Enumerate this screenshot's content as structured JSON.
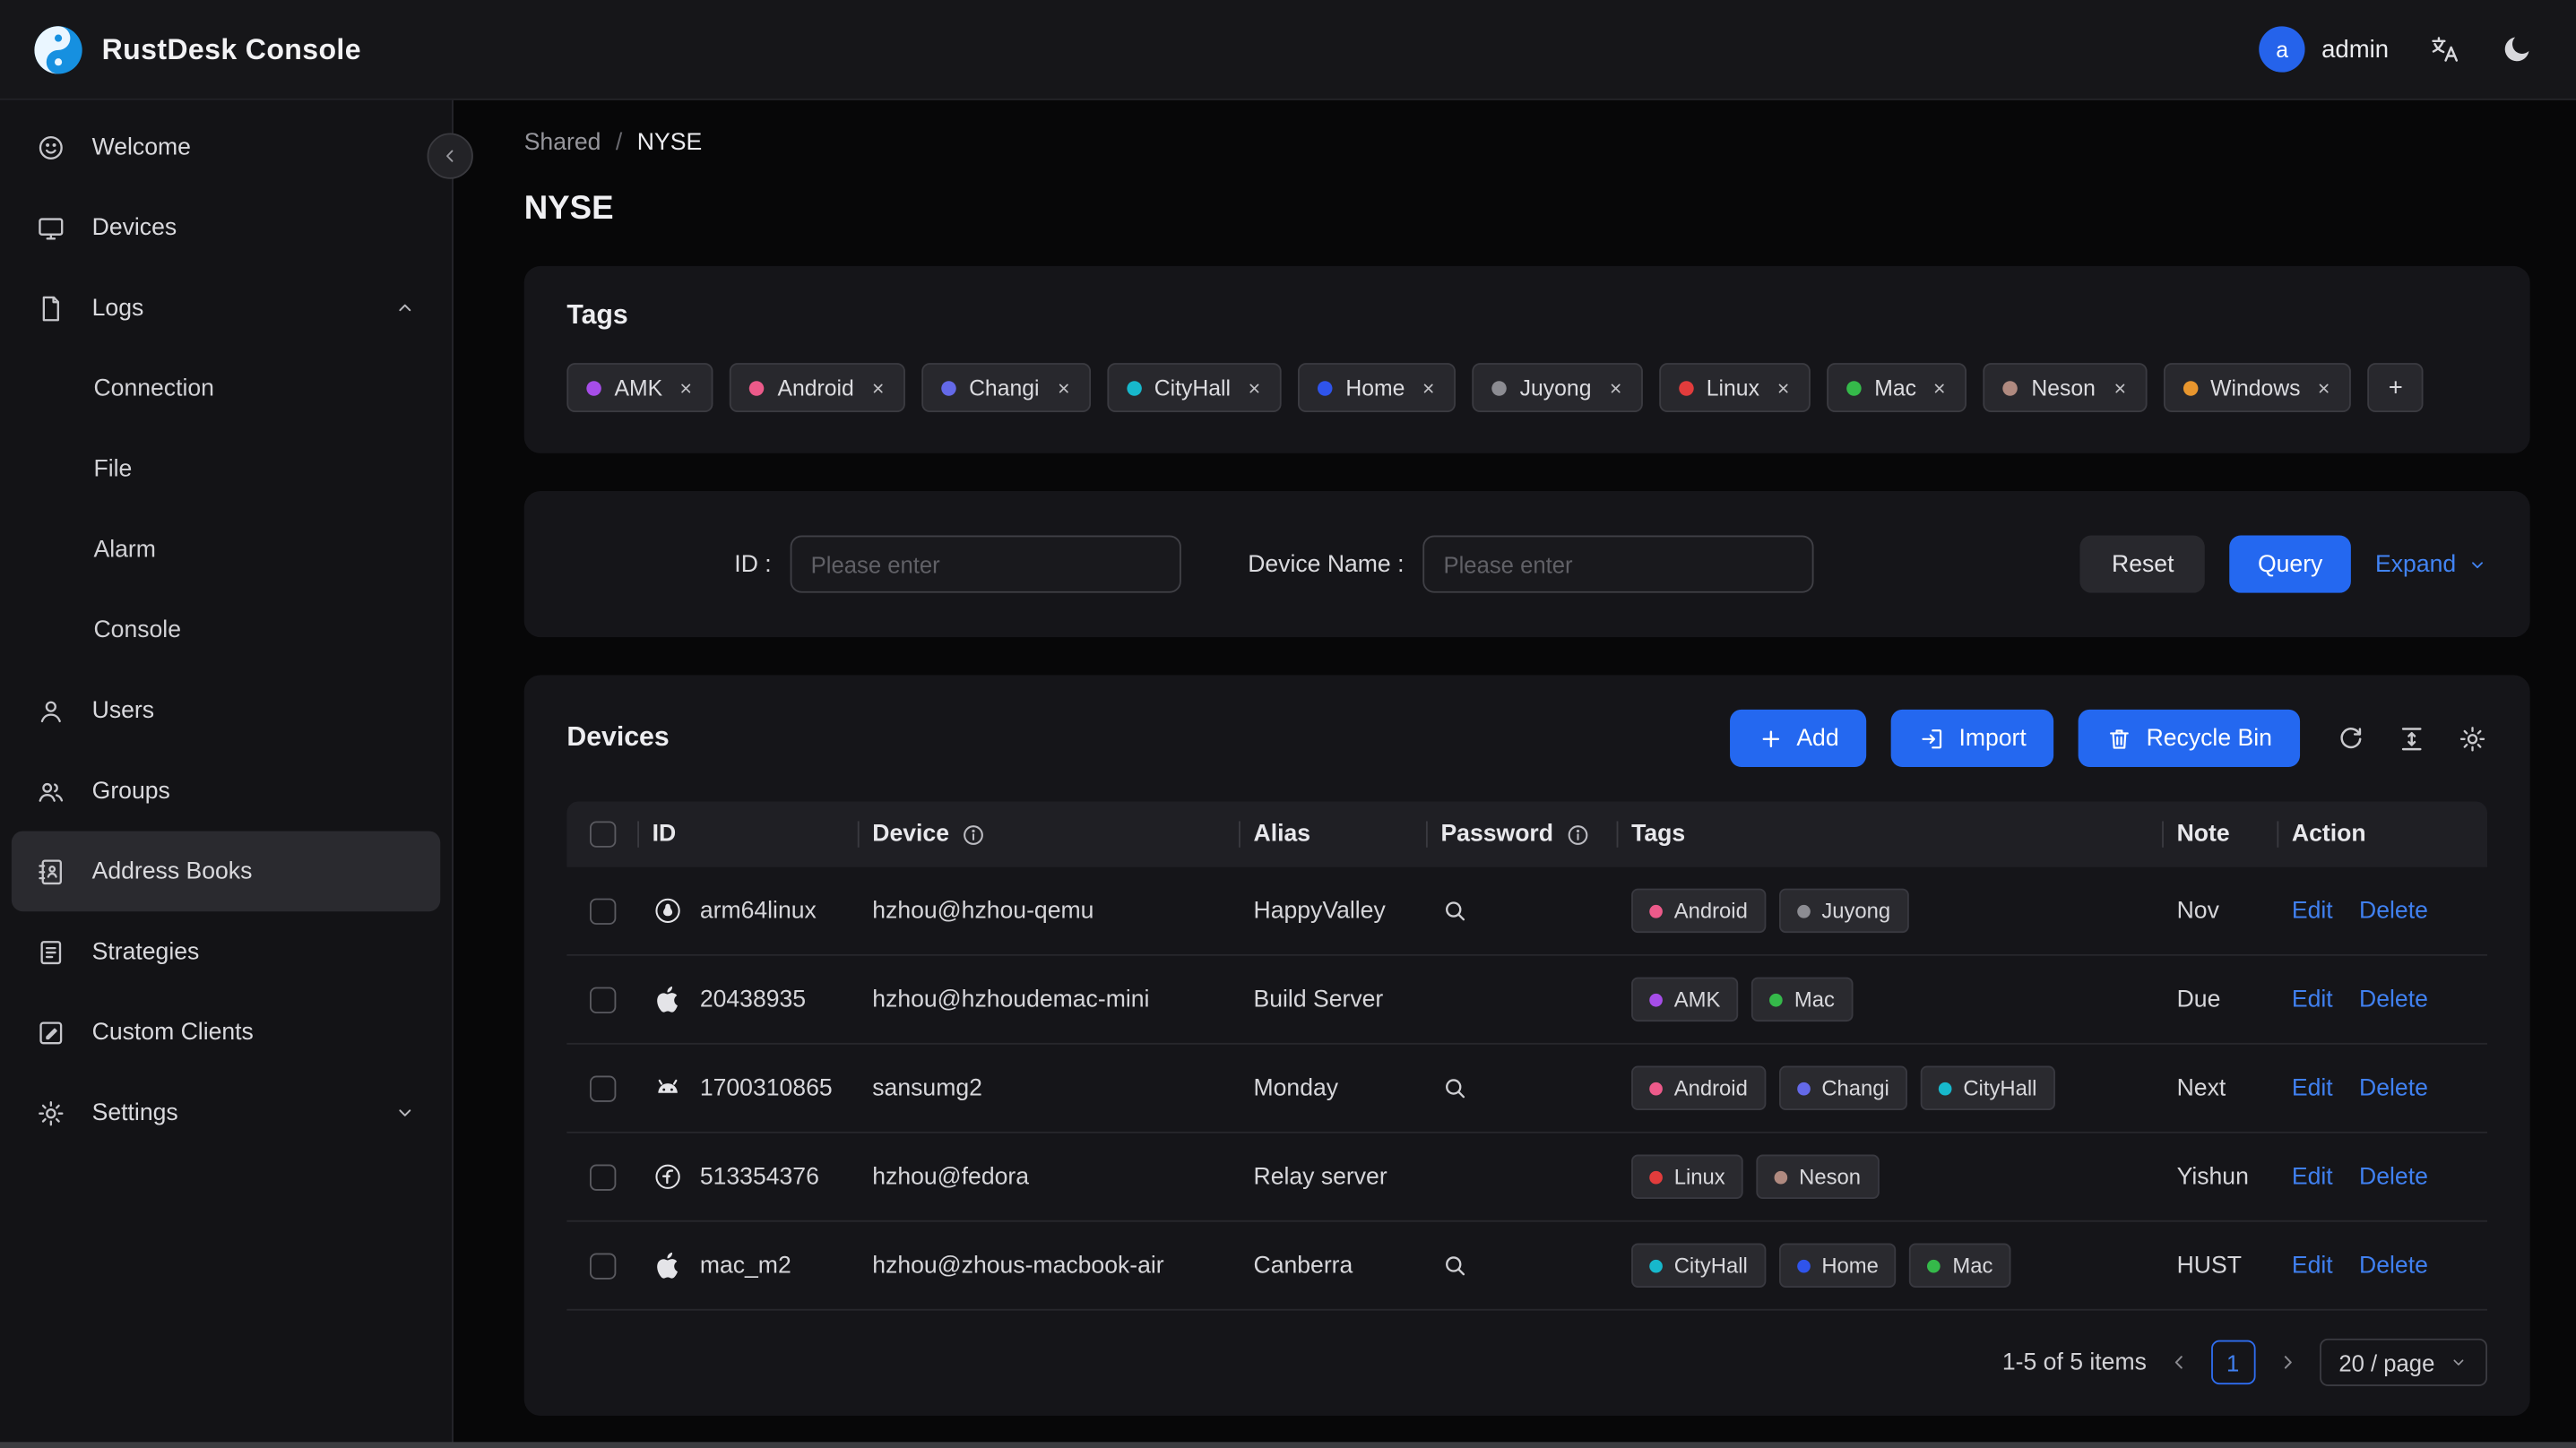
{
  "theme": {
    "accent": "#2468f0",
    "link": "#4080f0",
    "avatar_bg": "#2563eb"
  },
  "header": {
    "app_title": "RustDesk Console",
    "avatar_letter": "a",
    "username": "admin"
  },
  "sidebar": {
    "items": [
      {
        "label": "Welcome"
      },
      {
        "label": "Devices"
      },
      {
        "label": "Logs"
      },
      {
        "label": "Users"
      },
      {
        "label": "Groups"
      },
      {
        "label": "Address Books"
      },
      {
        "label": "Strategies"
      },
      {
        "label": "Custom Clients"
      },
      {
        "label": "Settings"
      }
    ],
    "logs_children": [
      {
        "label": "Connection"
      },
      {
        "label": "File"
      },
      {
        "label": "Alarm"
      },
      {
        "label": "Console"
      }
    ]
  },
  "breadcrumb": {
    "parent": "Shared",
    "separator": "/",
    "current": "NYSE"
  },
  "page": {
    "title": "NYSE"
  },
  "tags_card": {
    "title": "Tags",
    "add_label": "+",
    "items": [
      {
        "label": "AMK",
        "color": "#a64de8"
      },
      {
        "label": "Android",
        "color": "#ec5a8a"
      },
      {
        "label": "Changi",
        "color": "#6469e8"
      },
      {
        "label": "CityHall",
        "color": "#17b8cc"
      },
      {
        "label": "Home",
        "color": "#2f54eb"
      },
      {
        "label": "Juyong",
        "color": "#8c8c92"
      },
      {
        "label": "Linux",
        "color": "#e23c3c"
      },
      {
        "label": "Mac",
        "color": "#35b94a"
      },
      {
        "label": "Neson",
        "color": "#b08a80"
      },
      {
        "label": "Windows",
        "color": "#e8962e"
      }
    ]
  },
  "filter": {
    "id_label": "ID :",
    "id_placeholder": "Please enter",
    "device_name_label": "Device Name :",
    "device_name_placeholder": "Please enter",
    "reset_label": "Reset",
    "query_label": "Query",
    "expand_label": "Expand"
  },
  "devices": {
    "title": "Devices",
    "add_label": "Add",
    "import_label": "Import",
    "recycle_label": "Recycle Bin",
    "columns": {
      "id": "ID",
      "device": "Device",
      "alias": "Alias",
      "password": "Password",
      "tags": "Tags",
      "note": "Note",
      "action": "Action"
    },
    "edit_label": "Edit",
    "delete_label": "Delete",
    "rows": [
      {
        "os": "linux",
        "id": "arm64linux",
        "device": "hzhou@hzhou-qemu",
        "alias": "HappyValley",
        "has_password": true,
        "tags": [
          {
            "label": "Android",
            "color": "#ec5a8a"
          },
          {
            "label": "Juyong",
            "color": "#8c8c92"
          }
        ],
        "note": "Nov"
      },
      {
        "os": "apple",
        "id": "20438935",
        "device": "hzhou@hzhoudemac-mini",
        "alias": "Build Server",
        "has_password": false,
        "tags": [
          {
            "label": "AMK",
            "color": "#a64de8"
          },
          {
            "label": "Mac",
            "color": "#35b94a"
          }
        ],
        "note": "Due"
      },
      {
        "os": "android",
        "id": "1700310865",
        "device": "sansumg2",
        "alias": "Monday",
        "has_password": true,
        "tags": [
          {
            "label": "Android",
            "color": "#ec5a8a"
          },
          {
            "label": "Changi",
            "color": "#6469e8"
          },
          {
            "label": "CityHall",
            "color": "#17b8cc"
          }
        ],
        "note": "Next"
      },
      {
        "os": "fedora",
        "id": "513354376",
        "device": "hzhou@fedora",
        "alias": "Relay server",
        "has_password": false,
        "tags": [
          {
            "label": "Linux",
            "color": "#e23c3c"
          },
          {
            "label": "Neson",
            "color": "#b08a80"
          }
        ],
        "note": "Yishun"
      },
      {
        "os": "apple",
        "id": "mac_m2",
        "device": "hzhou@zhous-macbook-air",
        "alias": "Canberra",
        "has_password": true,
        "tags": [
          {
            "label": "CityHall",
            "color": "#17b8cc"
          },
          {
            "label": "Home",
            "color": "#2f54eb"
          },
          {
            "label": "Mac",
            "color": "#35b94a"
          }
        ],
        "note": "HUST"
      }
    ],
    "pagination": {
      "summary": "1-5 of 5 items",
      "page": "1",
      "page_size": "20 / page"
    }
  }
}
